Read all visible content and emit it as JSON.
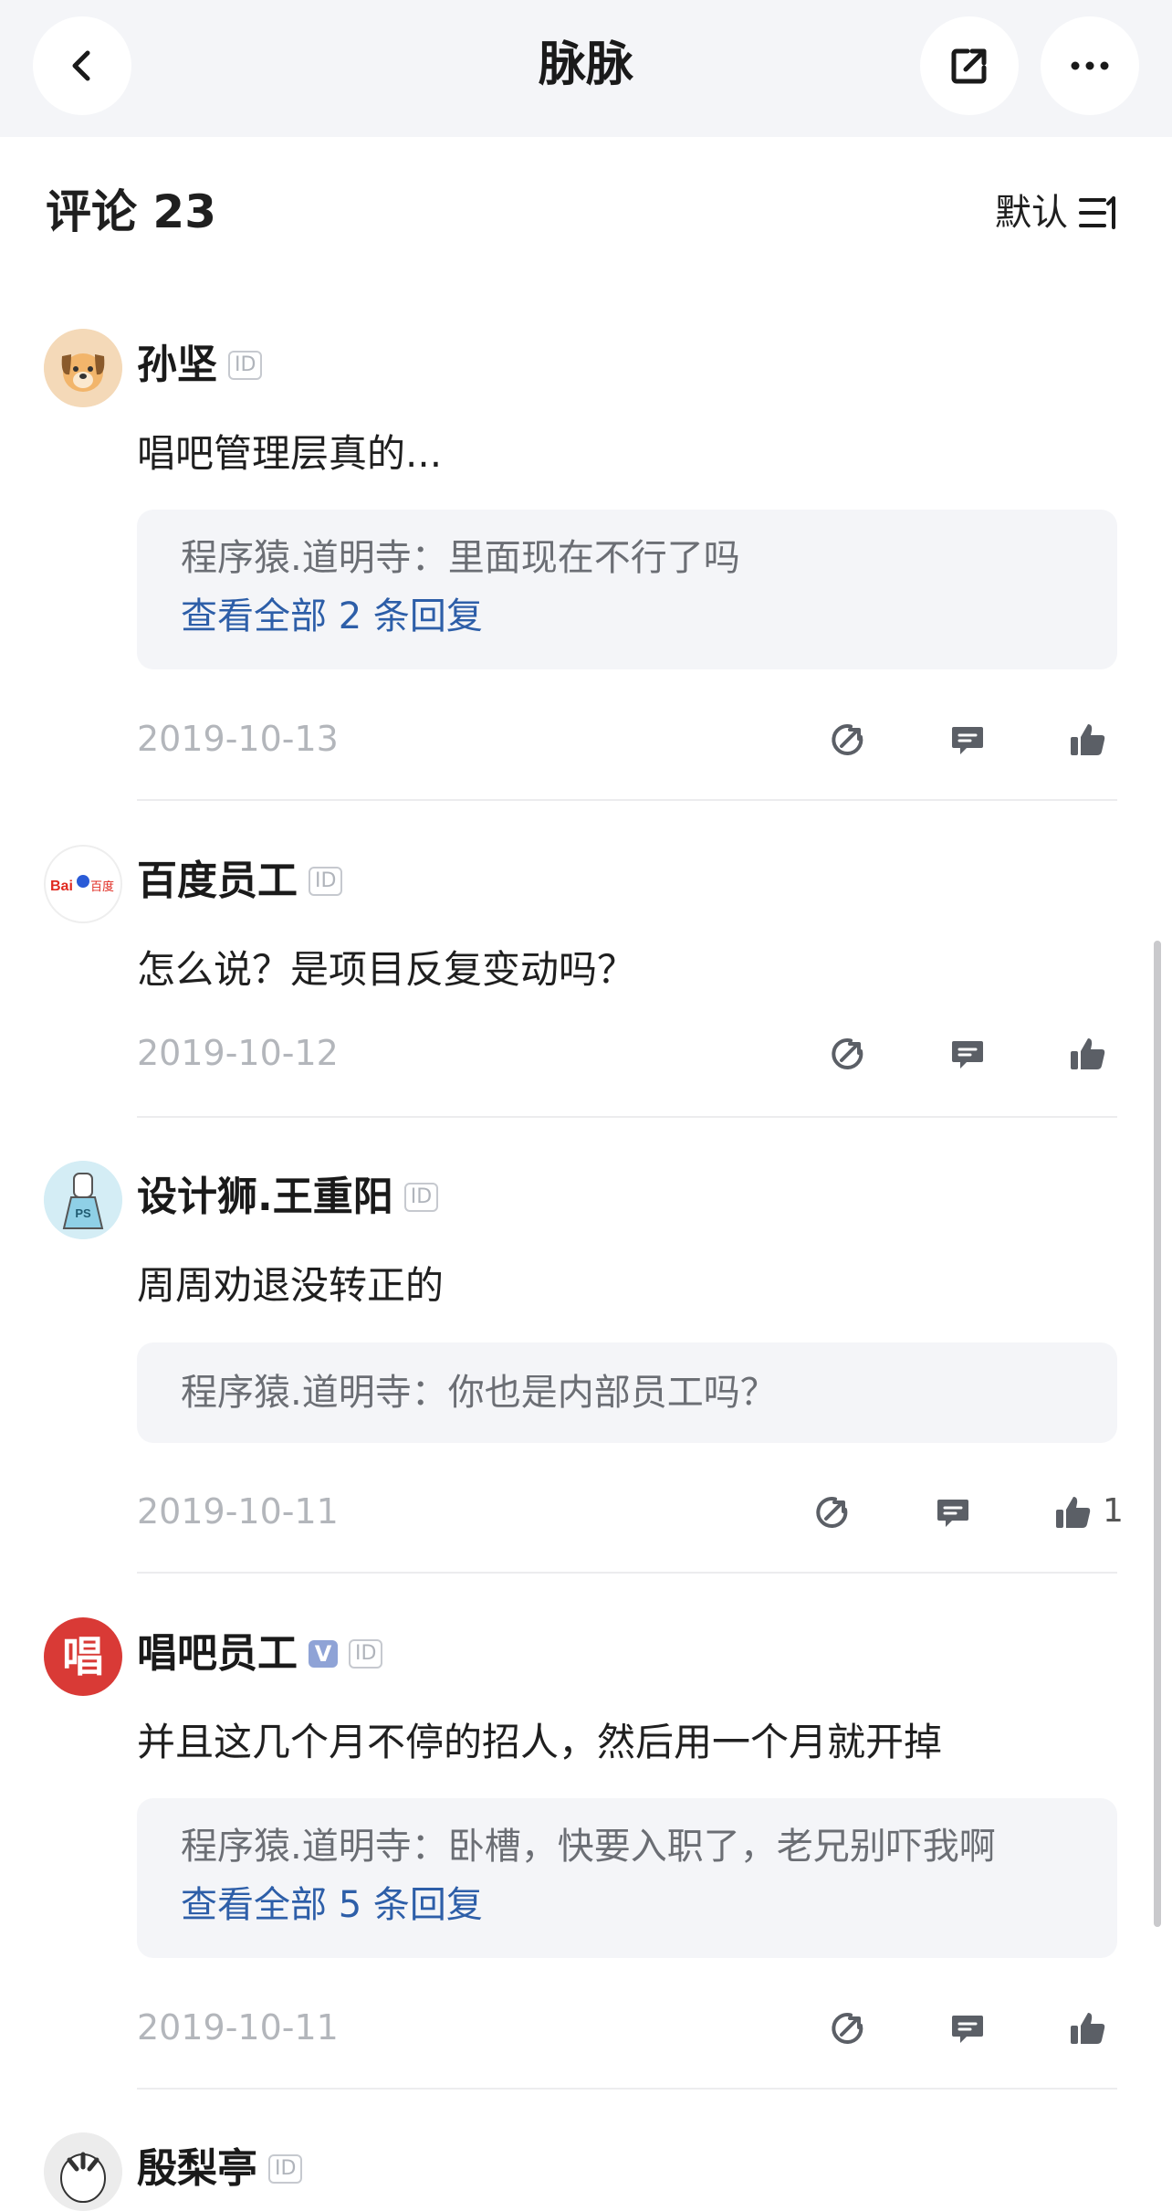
{
  "header": {
    "title": "脉脉",
    "back_icon": "chevron-left-icon",
    "share_icon": "share-external-icon",
    "more_icon": "more-dots-icon"
  },
  "comments_header": {
    "label": "评论 23",
    "sort_label": "默认",
    "sort_icon": "sort-lines-icon"
  },
  "comments": [
    {
      "author": "孙坚",
      "badge": "ID",
      "text": "唱吧管理层真的...",
      "reply": {
        "line": "程序猿.道明寺：里面现在不行了吗",
        "more": "查看全部 2 条回复"
      },
      "date": "2019-10-13",
      "likes": ""
    },
    {
      "author": "百度员工",
      "badge": "ID",
      "text": "怎么说？是项目反复变动吗？",
      "avatar_text": "Bai百度",
      "date": "2019-10-12",
      "likes": ""
    },
    {
      "author": "设计狮.王重阳",
      "badge": "ID",
      "text": "周周劝退没转正的",
      "avatar_text": "PS",
      "reply": {
        "line": "程序猿.道明寺：你也是内部员工吗？"
      },
      "date": "2019-10-11",
      "likes": "1"
    },
    {
      "author": "唱吧员工",
      "verified": "V",
      "badge": "ID",
      "text": "并且这几个月不停的招人，然后用一个月就开掉",
      "avatar_text": "唱",
      "reply": {
        "line": "程序猿.道明寺：卧槽，快要入职了，老兄别吓我啊",
        "more": "查看全部 5 条回复"
      },
      "date": "2019-10-11",
      "likes": ""
    },
    {
      "author": "殷梨亭",
      "badge": "ID"
    }
  ],
  "colors": {
    "link_blue": "#2d5ea8",
    "header_bg": "#f4f5f8",
    "reply_bg": "#f4f5f8",
    "date_gray": "#b3b6bb",
    "icon_gray": "#5b5f66"
  }
}
